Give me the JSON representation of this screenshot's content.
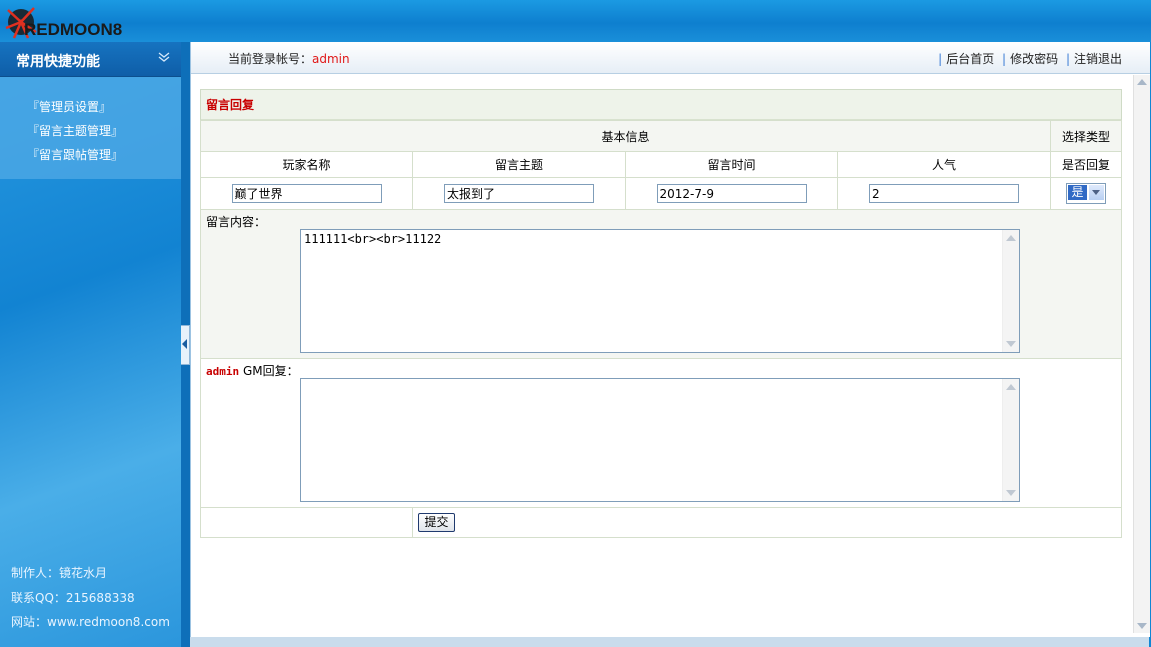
{
  "app": {
    "logo_text": "REDMOON8"
  },
  "sidebar": {
    "title": "常用快捷功能",
    "items": [
      {
        "label": "『管理员设置』"
      },
      {
        "label": "『留言主题管理』"
      },
      {
        "label": "『留言跟帖管理』"
      }
    ],
    "footer": {
      "author": "制作人：镜花水月",
      "qq": "联系QQ：215688338",
      "website": "网站：www.redmoon8.com"
    }
  },
  "header": {
    "login_label": "当前登录帐号：",
    "login_user": "admin",
    "links": [
      {
        "label": "后台首页"
      },
      {
        "label": "修改密码"
      },
      {
        "label": "注销退出"
      }
    ]
  },
  "form": {
    "title": "留言回复",
    "section_basic": "基本信息",
    "section_type": "选择类型",
    "columns": [
      "玩家名称",
      "留言主题",
      "留言时间",
      "人气",
      "是否回复"
    ],
    "player_name": "巅了世界",
    "topic": "太报到了",
    "time": "2012-7-9",
    "popularity": "2",
    "reply_select": "是",
    "content_label": "留言内容：",
    "content_value": "111111<br><br>11122",
    "reply_user": "admin",
    "reply_label": " GM回复：",
    "reply_value": "",
    "submit_label": "提交"
  }
}
